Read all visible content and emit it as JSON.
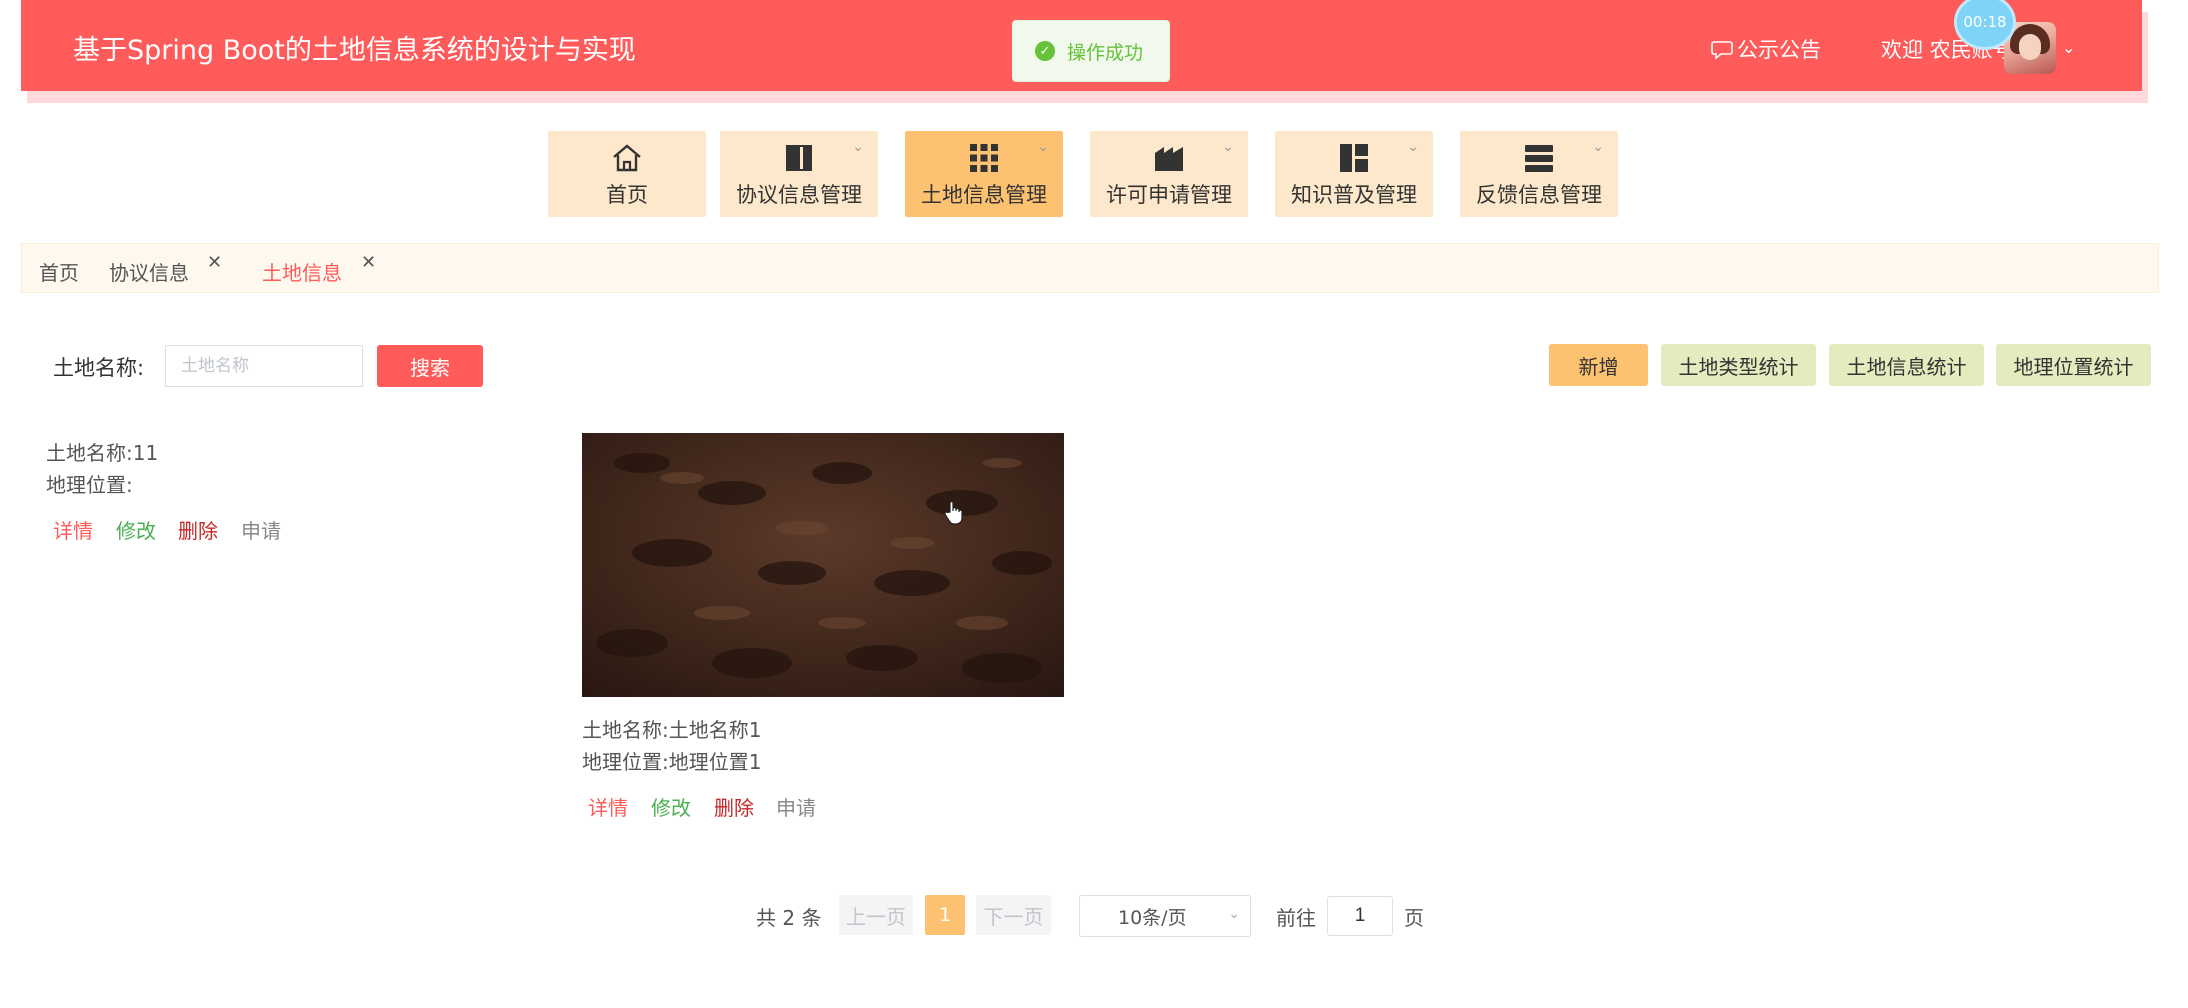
{
  "header": {
    "title": "基于Spring Boot的土地信息系统的设计与实现",
    "notice_label": "公示公告",
    "welcome": "欢迎 农民账号1",
    "timer": "00:18"
  },
  "toast": {
    "message": "操作成功"
  },
  "nav": {
    "items": [
      {
        "label": "首页",
        "icon": "home-icon"
      },
      {
        "label": "协议信息管理",
        "icon": "book-icon"
      },
      {
        "label": "土地信息管理",
        "icon": "grid-icon"
      },
      {
        "label": "许可申请管理",
        "icon": "factory-icon"
      },
      {
        "label": "知识普及管理",
        "icon": "layout-icon"
      },
      {
        "label": "反馈信息管理",
        "icon": "list-icon"
      }
    ]
  },
  "tabs": [
    {
      "label": "首页"
    },
    {
      "label": "协议信息"
    },
    {
      "label": "土地信息"
    }
  ],
  "search": {
    "label": "土地名称:",
    "placeholder": "土地名称",
    "button": "搜索"
  },
  "toolbar": {
    "add": "新增",
    "stat_type": "土地类型统计",
    "stat_info": "土地信息统计",
    "stat_location": "地理位置统计"
  },
  "cards": [
    {
      "name_label": "土地名称:",
      "name": "11",
      "location_label": "地理位置:",
      "location": ""
    },
    {
      "name_label": "土地名称:",
      "name": "土地名称1",
      "location_label": "地理位置:",
      "location": "地理位置1"
    }
  ],
  "actions": {
    "detail": "详情",
    "edit": "修改",
    "delete": "删除",
    "apply": "申请"
  },
  "pagination": {
    "total": "共 2 条",
    "prev": "上一页",
    "current": "1",
    "next": "下一页",
    "page_size": "10条/页",
    "goto": "前往",
    "goto_value": "1",
    "unit": "页"
  },
  "colors": {
    "primary": "#ff5b5b",
    "accent": "#fcc171",
    "stat_button": "#e5ebbe",
    "success": "#67c23a"
  }
}
